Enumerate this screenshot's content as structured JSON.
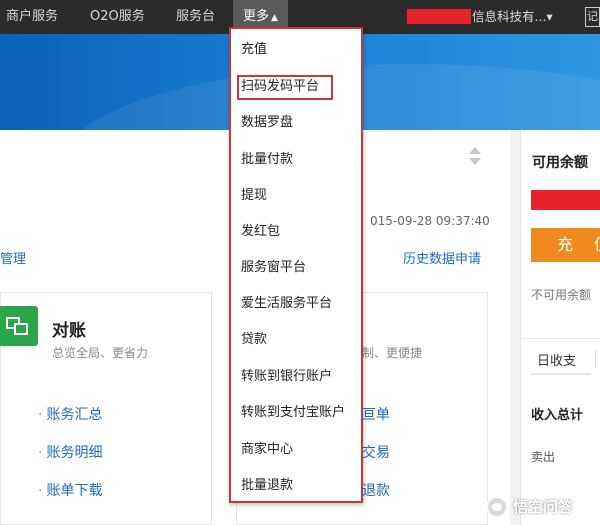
{
  "topnav": {
    "items": [
      "商户服务",
      "O2O服务",
      "服务台"
    ],
    "more_label": "更多",
    "company": "信息科技有...▾",
    "last_tab": "记"
  },
  "dropdown": {
    "items": [
      "充值",
      "扫码发码平台",
      "数据罗盘",
      "批量付款",
      "提现",
      "发红包",
      "服务窗平台",
      "爱生活服务平台",
      "贷款",
      "转账到银行账户",
      "转账到支付宝账户",
      "商家中心",
      "批量退款"
    ],
    "highlighted": "扫码发码平台"
  },
  "main": {
    "timestamp": "015-09-28 09:37:40",
    "left_link": "管理",
    "history_link": "历史数据申请",
    "card_left": {
      "title": "对账",
      "subtitle": "总览全局、更省力",
      "links": [
        "账务汇总",
        "账务明细",
        "账单下载"
      ]
    },
    "card_right": {
      "subtitle": "制、更便捷",
      "links": [
        "亘单",
        "交易",
        "退款"
      ]
    }
  },
  "balance": {
    "title": "可用余额",
    "recharge": "充 值",
    "unavailable": "不可用余额",
    "tab": "日收支",
    "income_total": "收入总计",
    "sale": "卖出"
  },
  "watermark": "悟空问答",
  "colors": {
    "nav_bg": "#2b2b2b",
    "banner_blue": "#1b82d6",
    "highlight_red": "#c8373b",
    "recharge_orange": "#f08a1d",
    "link_blue": "#1b6dbd",
    "card_green": "#2aa54a"
  }
}
